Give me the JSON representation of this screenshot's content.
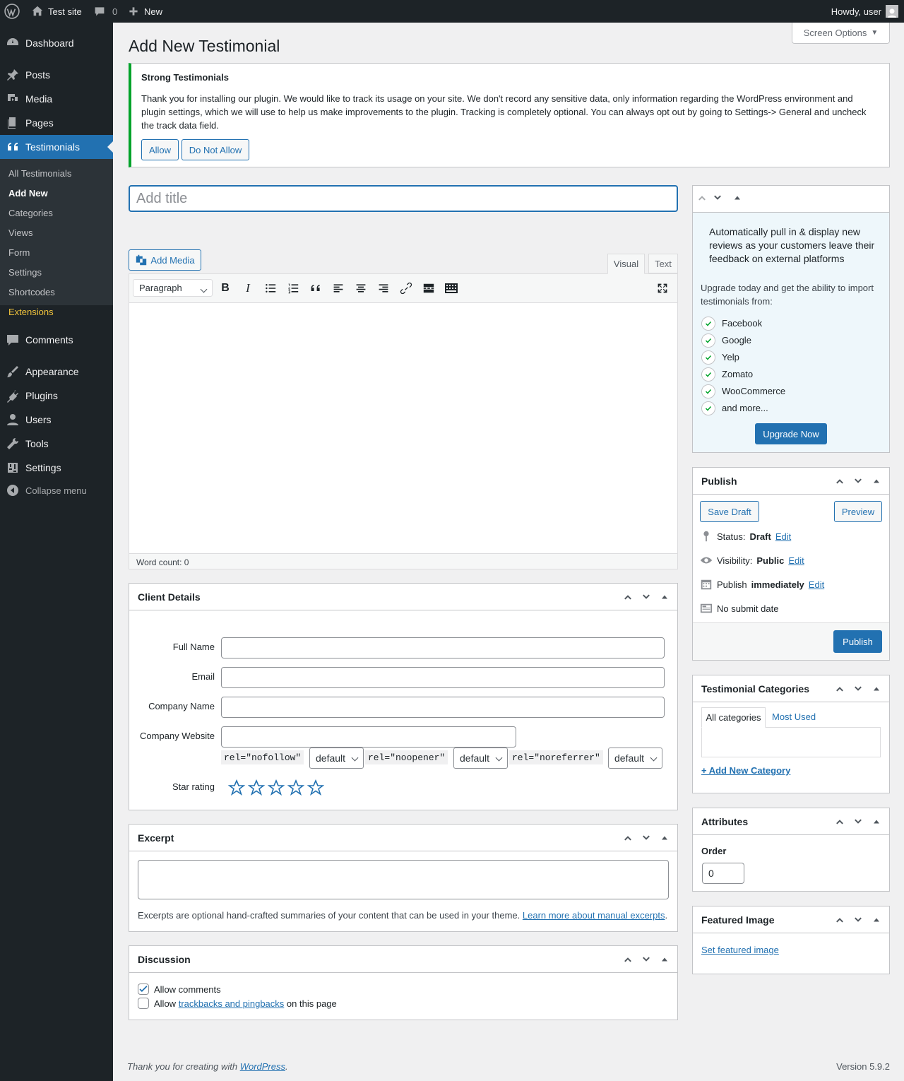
{
  "admin_bar": {
    "site_name": "Test site",
    "comments_count": "0",
    "new_label": "New",
    "howdy": "Howdy, user"
  },
  "sidebar": {
    "items": [
      {
        "label": "Dashboard",
        "icon": "dashboard-icon"
      },
      {
        "label": "Posts",
        "icon": "pin-icon"
      },
      {
        "label": "Media",
        "icon": "media-icon"
      },
      {
        "label": "Pages",
        "icon": "pages-icon"
      },
      {
        "label": "Testimonials",
        "icon": "quote-icon"
      },
      {
        "label": "Comments",
        "icon": "comment-icon"
      },
      {
        "label": "Appearance",
        "icon": "brush-icon"
      },
      {
        "label": "Plugins",
        "icon": "plugin-icon"
      },
      {
        "label": "Users",
        "icon": "user-icon"
      },
      {
        "label": "Tools",
        "icon": "wrench-icon"
      },
      {
        "label": "Settings",
        "icon": "settings-icon"
      },
      {
        "label": "Collapse menu",
        "icon": "collapse-icon"
      }
    ],
    "submenu": [
      "All Testimonials",
      "Add New",
      "Categories",
      "Views",
      "Form",
      "Settings",
      "Shortcodes",
      "Extensions"
    ]
  },
  "screen_options": "Screen Options",
  "page_title": "Add New Testimonial",
  "notice": {
    "title": "Strong Testimonials",
    "text": "Thank you for installing our plugin. We would like to track its usage on your site. We don't record any sensitive data, only information regarding the WordPress environment and plugin settings, which we will use to help us make improvements to the plugin. Tracking is completely optional. You can always opt out by going to Settings-> General and uncheck the track data field.",
    "allow": "Allow",
    "deny": "Do Not Allow"
  },
  "editor": {
    "title_placeholder": "Add title",
    "add_media": "Add Media",
    "tab_visual": "Visual",
    "tab_text": "Text",
    "format": "Paragraph",
    "word_count": "Word count: 0"
  },
  "client_details": {
    "title": "Client Details",
    "full_name": "Full Name",
    "email": "Email",
    "company_name": "Company Name",
    "company_website": "Company Website",
    "rel_nofollow": "rel=\"nofollow\"",
    "rel_noopener": "rel=\"noopener\"",
    "rel_noreferrer": "rel=\"noreferrer\"",
    "default": "default",
    "star_rating": "Star rating",
    "stars": 0
  },
  "excerpt": {
    "title": "Excerpt",
    "help": "Excerpts are optional hand-crafted summaries of your content that can be used in your theme.",
    "link": "Learn more about manual excerpts",
    "period": "."
  },
  "discussion": {
    "title": "Discussion",
    "allow_comments": "Allow comments",
    "allow_prefix": "Allow",
    "trackbacks_link": "trackbacks and pingbacks",
    "allow_suffix": "on this page"
  },
  "promo": {
    "heading": "Automatically pull in & display new reviews as your customers leave their feedback on external platforms",
    "text": "Upgrade today and get the ability to import testimonials from:",
    "features": [
      "Facebook",
      "Google",
      "Yelp",
      "Zomato",
      "WooCommerce",
      "and more..."
    ],
    "button": "Upgrade Now"
  },
  "publish": {
    "title": "Publish",
    "save_draft": "Save Draft",
    "preview": "Preview",
    "status_label": "Status:",
    "status_value": "Draft",
    "visibility_label": "Visibility:",
    "visibility_value": "Public",
    "publish_label": "Publish",
    "publish_value": "immediately",
    "edit": "Edit",
    "no_submit": "No submit date",
    "publish_button": "Publish"
  },
  "categories": {
    "title": "Testimonial Categories",
    "tab_all": "All categories",
    "tab_most": "Most Used",
    "add_new": "+ Add New Category"
  },
  "attributes": {
    "title": "Attributes",
    "order_label": "Order",
    "order_value": "0"
  },
  "featured": {
    "title": "Featured Image",
    "link": "Set featured image"
  },
  "footer": {
    "thanks_prefix": "Thank you for creating with",
    "wordpress": "WordPress",
    "thanks_suffix": ".",
    "version": "Version 5.9.2"
  },
  "colors": {
    "accent": "#2271b1",
    "notice_border": "#00a32a",
    "admin_bar": "#1d2327"
  }
}
